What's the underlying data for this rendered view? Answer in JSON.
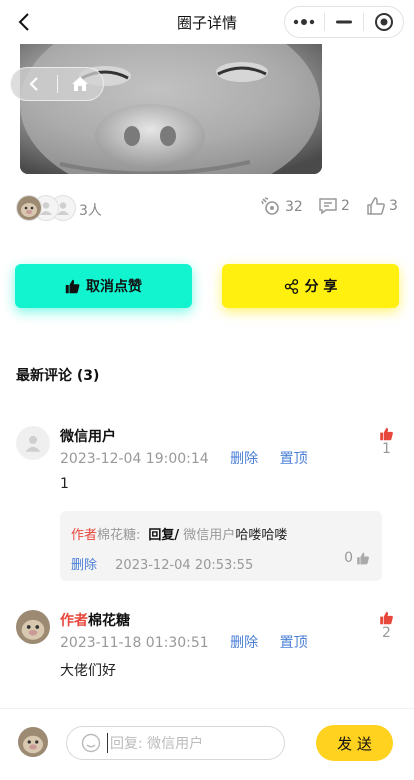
{
  "nav": {
    "title": "圈子详情"
  },
  "stats": {
    "people": "3人",
    "views": "32",
    "comments": "2",
    "likes": "3"
  },
  "actions": {
    "unlike_label": "取消点赞",
    "share_label": "分 享"
  },
  "comments_section": {
    "title": "最新评论 (3)"
  },
  "comments": [
    {
      "name": "微信用户",
      "time": "2023-12-04 19:00:14",
      "delete_label": "删除",
      "pin_label": "置顶",
      "like_count": "1",
      "text": "1",
      "reply": {
        "author_tag": "作者",
        "author_name": "棉花糖:",
        "reply_label": "回复/",
        "target": "微信用户",
        "content": "哈喽哈喽",
        "delete_label": "删除",
        "time": "2023-12-04 20:53:55",
        "like_count": "0"
      }
    },
    {
      "author_tag": "作者",
      "name": "棉花糖",
      "time": "2023-11-18 01:30:51",
      "delete_label": "删除",
      "pin_label": "置顶",
      "like_count": "2",
      "text": "大佬们好"
    }
  ],
  "input": {
    "placeholder": "回复: 微信用户",
    "send_label": "发 送"
  },
  "colors": {
    "mint": "#12f3cf",
    "yellow": "#fff00f",
    "send": "#ffd21f",
    "red": "#e8473c",
    "link": "#4a7fd6"
  }
}
